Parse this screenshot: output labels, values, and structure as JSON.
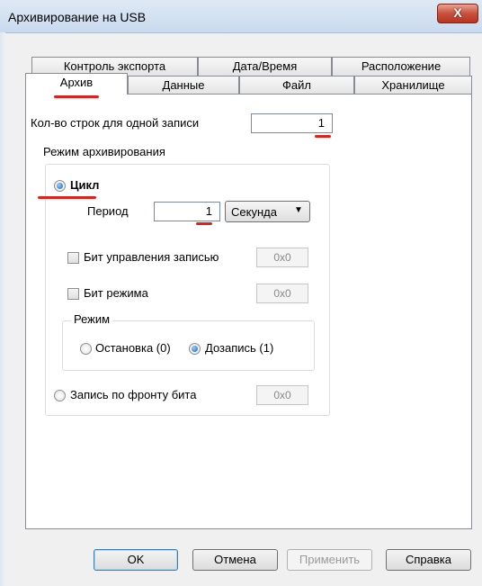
{
  "window": {
    "title": "Архивирование на USB",
    "close_label": "X"
  },
  "tabs": {
    "row1": [
      "Контроль экспорта",
      "Дата/Время",
      "Расположение"
    ],
    "row2": [
      "Архив",
      "Данные",
      "Файл",
      "Хранилище"
    ],
    "active": "Архив"
  },
  "records": {
    "label": "Кол-во строк для одной записи",
    "value": "1"
  },
  "archive_mode": {
    "label": "Режим архивирования",
    "cycle": {
      "label": "Цикл",
      "selected": true,
      "period_label": "Период",
      "period_value": "1",
      "unit": "Секунда"
    },
    "write_control_bit": {
      "label": "Бит управления записью",
      "checked": false,
      "address": "0x0"
    },
    "mode_bit": {
      "label": "Бит режима",
      "checked": false,
      "address": "0x0"
    },
    "mode_group": {
      "label": "Режим",
      "options": [
        "Остановка (0)",
        "Дозапись (1)"
      ],
      "selected": "Дозапись (1)"
    },
    "edge_write": {
      "label": "Запись по фронту бита",
      "selected": false,
      "address": "0x0"
    }
  },
  "buttons": {
    "ok": "OK",
    "cancel": "Отмена",
    "apply": "Применить",
    "help": "Справка"
  },
  "colors": {
    "annotation": "#e0201a",
    "accent": "#1d62b8"
  }
}
